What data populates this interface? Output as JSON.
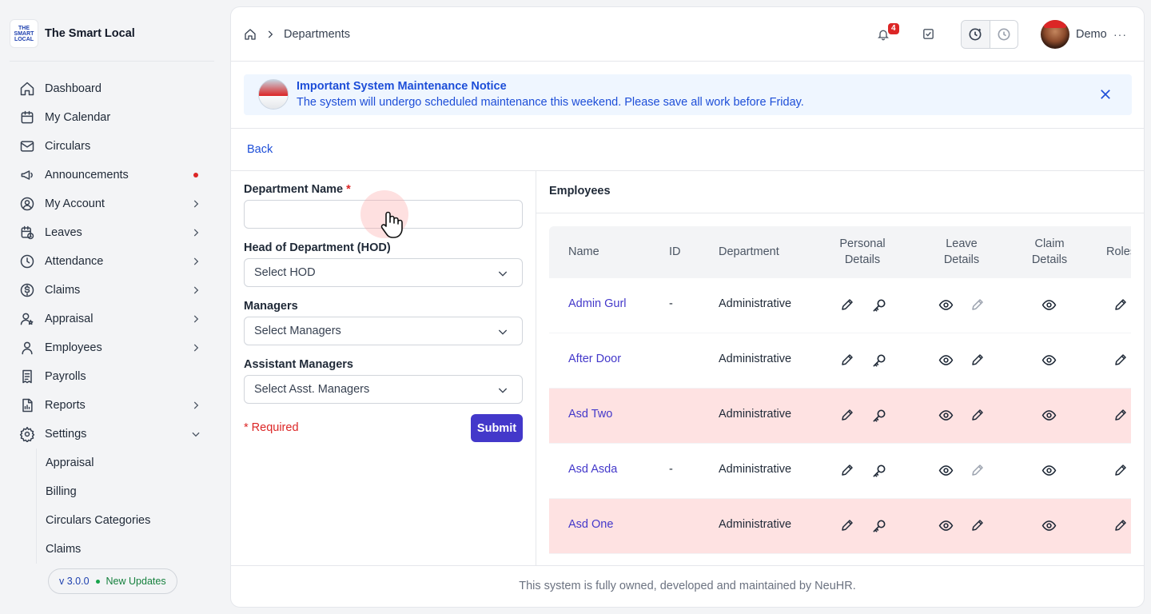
{
  "brand": {
    "name": "The Smart Local",
    "logo_lines": [
      "THE",
      "SMART",
      "LOCAL"
    ]
  },
  "sidebar": {
    "items": [
      {
        "label": "Dashboard",
        "icon": "home-icon",
        "chevron": false,
        "dot": false
      },
      {
        "label": "My Calendar",
        "icon": "calendar-icon",
        "chevron": false,
        "dot": false
      },
      {
        "label": "Circulars",
        "icon": "mail-icon",
        "chevron": false,
        "dot": false
      },
      {
        "label": "Announcements",
        "icon": "megaphone-icon",
        "chevron": false,
        "dot": true
      },
      {
        "label": "My Account",
        "icon": "user-circle-icon",
        "chevron": true,
        "dot": false
      },
      {
        "label": "Leaves",
        "icon": "calendar-clock-icon",
        "chevron": true,
        "dot": false
      },
      {
        "label": "Attendance",
        "icon": "clock-icon",
        "chevron": true,
        "dot": false
      },
      {
        "label": "Claims",
        "icon": "dollar-circle-icon",
        "chevron": true,
        "dot": false
      },
      {
        "label": "Appraisal",
        "icon": "user-star-icon",
        "chevron": true,
        "dot": false
      },
      {
        "label": "Employees",
        "icon": "user-icon",
        "chevron": true,
        "dot": false
      },
      {
        "label": "Payrolls",
        "icon": "receipt-icon",
        "chevron": false,
        "dot": false
      },
      {
        "label": "Reports",
        "icon": "report-icon",
        "chevron": true,
        "dot": false
      },
      {
        "label": "Settings",
        "icon": "gear-icon",
        "chevron": true,
        "dot": false,
        "expanded": true
      }
    ],
    "sub_items": [
      "Appraisal",
      "Billing",
      "Circulars Categories",
      "Claims"
    ],
    "version": "v 3.0.0",
    "updates": "New Updates"
  },
  "header": {
    "breadcrumb": "Departments",
    "notif_count": "4",
    "user": "Demo",
    "more": "···"
  },
  "notice": {
    "title": "Important System Maintenance Notice",
    "message": "The system will undergo scheduled maintenance this weekend. Please save all work before Friday."
  },
  "back_label": "Back",
  "form": {
    "dept_label": "Department Name",
    "req_mark": "*",
    "dept_value": "",
    "hod_label": "Head of Department (HOD)",
    "hod_value": "Select HOD",
    "managers_label": "Managers",
    "managers_value": "Select Managers",
    "asst_label": "Assistant Managers",
    "asst_value": "Select Asst. Managers",
    "required_note": "* Required",
    "submit": "Submit"
  },
  "employees": {
    "title": "Employees",
    "columns": {
      "name": "Name",
      "id": "ID",
      "dept": "Department",
      "personal": [
        "Personal",
        "Details"
      ],
      "leave": [
        "Leave",
        "Details"
      ],
      "claim": [
        "Claim",
        "Details"
      ],
      "roles": "Roles"
    },
    "rows": [
      {
        "name": "Admin Gurl",
        "id": "-",
        "dept": "Administrative",
        "highlight": false,
        "leave_edit_enabled": false
      },
      {
        "name": "After Door",
        "id": "",
        "dept": "Administrative",
        "highlight": false,
        "leave_edit_enabled": true
      },
      {
        "name": "Asd Two",
        "id": "",
        "dept": "Administrative",
        "highlight": true,
        "leave_edit_enabled": true
      },
      {
        "name": "Asd Asda",
        "id": "-",
        "dept": "Administrative",
        "highlight": false,
        "leave_edit_enabled": false
      },
      {
        "name": "Asd One",
        "id": "",
        "dept": "Administrative",
        "highlight": true,
        "leave_edit_enabled": true
      }
    ]
  },
  "footer": "This system is fully owned, developed and maintained by NeuHR."
}
